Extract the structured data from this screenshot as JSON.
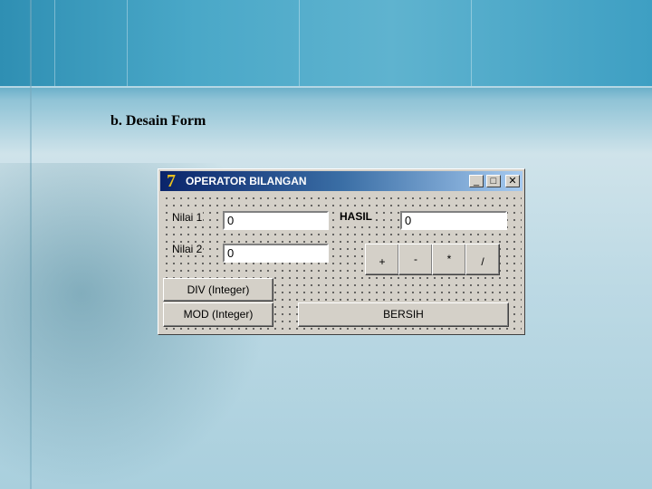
{
  "slide": {
    "heading": "b. Desain Form"
  },
  "window": {
    "title": "OPERATOR BILANGAN",
    "minimize_glyph": "_",
    "maximize_glyph": "□",
    "close_glyph": "✕",
    "icon_glyph": "7"
  },
  "form": {
    "nilai1_label": "Nilai 1",
    "nilai1_value": "0",
    "nilai2_label": "Nilai 2",
    "nilai2_value": "0",
    "hasil_label": "HASIL",
    "hasil_value": "0",
    "buttons": {
      "plus": "+",
      "minus": "-",
      "multiply": "*",
      "divide": "/",
      "div_integer": "DIV (Integer)",
      "mod_integer": "MOD (Integer)",
      "bersih": "BERSIH"
    }
  },
  "colors": {
    "titlebar_start": "#0a246a",
    "titlebar_end": "#a6caf0",
    "window_face": "#d4d0c8"
  }
}
